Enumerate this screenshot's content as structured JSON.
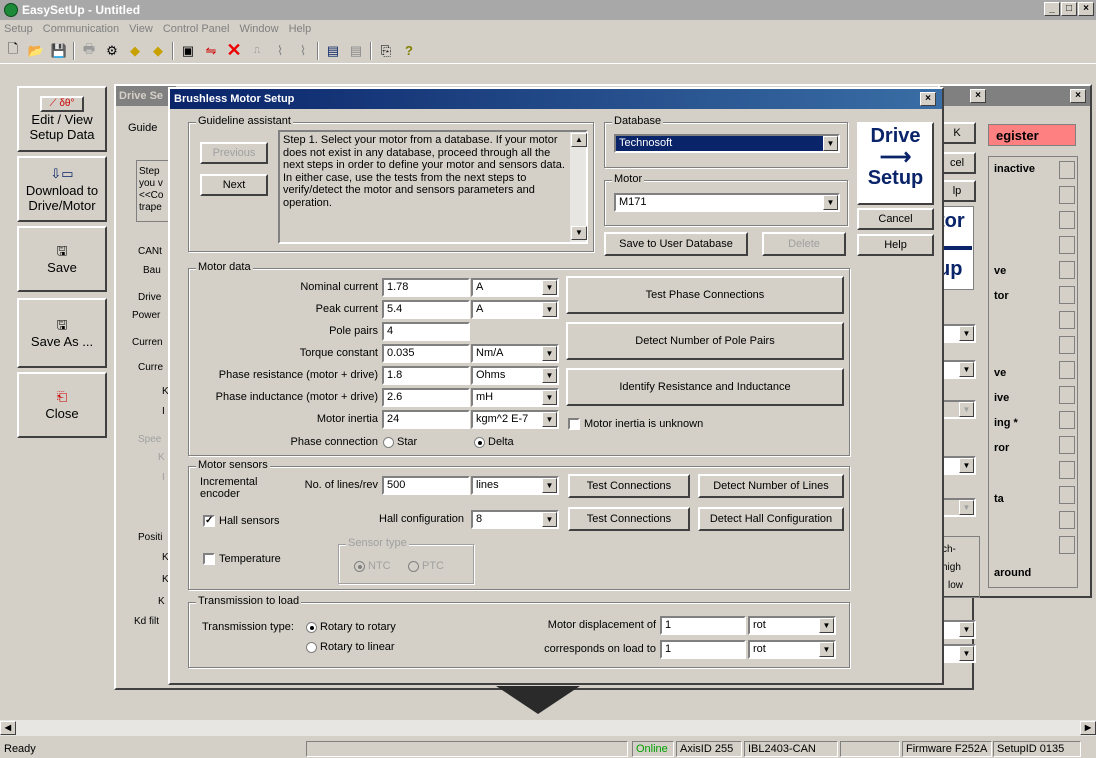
{
  "app": {
    "title": "EasySetUp - Untitled"
  },
  "menu": [
    "Setup",
    "Communication",
    "View",
    "Control Panel",
    "Window",
    "Help"
  ],
  "toolbar_icons": [
    "new-icon",
    "open-icon",
    "save-icon",
    "print-icon",
    "setup-icon",
    "go-icon",
    "go2-icon",
    "stop-icon",
    "chart-icon",
    "close-red-icon",
    "start-icon",
    "motion1-icon",
    "motion2-icon",
    "start2-icon",
    "stop2-icon",
    "comm-icon",
    "help-icon"
  ],
  "left_panel": {
    "buttons": [
      {
        "label": "Edit / View Setup Data",
        "icon": "edit-icon"
      },
      {
        "label": "Download to Drive/Motor",
        "icon": "download-icon"
      },
      {
        "label": "Save",
        "icon": "disk-icon"
      },
      {
        "label": "Save As ...",
        "icon": "disk-icon"
      },
      {
        "label": "Close",
        "icon": "close-icon"
      }
    ]
  },
  "drive_setup_window": {
    "title": "Drive Se",
    "labels": [
      "Guide",
      "Step",
      "you v",
      "<<Co",
      "trape",
      "CANt",
      "Bau",
      "Drive",
      "Power",
      "Curren",
      "Curre",
      "K",
      "I",
      "Spee",
      "K",
      "I",
      "Positi",
      "K",
      "K",
      "K",
      "Kd filt"
    ]
  },
  "register_window": {
    "title": "egister",
    "inactive": "inactive",
    "items": [
      "ve",
      "tor",
      "ve",
      "ive",
      "ing *",
      "ror",
      "ta",
      "around"
    ],
    "side_text": [
      "ch-",
      "high",
      "low"
    ],
    "buttons": [
      "K",
      "cel",
      "lp"
    ]
  },
  "dialog": {
    "title": "Brushless Motor Setup",
    "buttons": {
      "ok_partial": "K",
      "cancel": "Cancel",
      "help": "Help"
    },
    "drive_setup_logo": {
      "line1": "Drive",
      "line2": "Setup",
      "behind1": "tor",
      "behind2": "up"
    },
    "guideline": {
      "label": "Guideline assistant",
      "previous": "Previous",
      "next": "Next",
      "text": "Step 1. Select your motor from a database. If your motor does not exist in any database, proceed through all the next steps in order to define your motor and sensors data. In either case, use the tests from the next steps to verify/detect the motor and sensors parameters and operation."
    },
    "database": {
      "label": "Database",
      "value": "Technosoft",
      "motor_label": "Motor",
      "motor_value": "M171",
      "save_btn": "Save to User Database",
      "delete_btn": "Delete"
    },
    "motor_data": {
      "label": "Motor data",
      "rows": [
        {
          "label": "Nominal current",
          "value": "1.78",
          "unit": "A"
        },
        {
          "label": "Peak current",
          "value": "5.4",
          "unit": "A"
        },
        {
          "label": "Pole pairs",
          "value": "4",
          "unit": ""
        },
        {
          "label": "Torque constant",
          "value": "0.035",
          "unit": "Nm/A"
        },
        {
          "label": "Phase resistance (motor + drive)",
          "value": "1.8",
          "unit": "Ohms"
        },
        {
          "label": "Phase inductance (motor + drive)",
          "value": "2.6",
          "unit": "mH"
        },
        {
          "label": "Motor inertia",
          "value": "24",
          "unit": "kgm^2 E-7"
        }
      ],
      "test_phase": "Test Phase Connections",
      "detect_pole": "Detect Number of Pole Pairs",
      "identify_rl": "Identify Resistance and Inductance",
      "inertia_unknown": "Motor inertia is unknown",
      "phase_connection": "Phase connection",
      "star": "Star",
      "delta": "Delta"
    },
    "motor_sensors": {
      "label": "Motor sensors",
      "incremental_encoder": "Incremental encoder",
      "lines_label": "No. of lines/rev",
      "lines_value": "500",
      "lines_unit": "lines",
      "test_connections": "Test Connections",
      "detect_lines": "Detect Number of Lines",
      "hall_sensors": "Hall sensors",
      "hall_config_label": "Hall configuration",
      "hall_config_value": "8",
      "detect_hall": "Detect Hall Configuration",
      "temperature": "Temperature",
      "sensor_type": "Sensor type",
      "ntc": "NTC",
      "ptc": "PTC"
    },
    "transmission": {
      "label": "Transmission to load",
      "type_label": "Transmission type:",
      "rotary_rotary": "Rotary to rotary",
      "rotary_linear": "Rotary to linear",
      "displacement_label": "Motor displacement of",
      "displacement_value": "1",
      "displacement_unit": "rot",
      "load_label": "corresponds on load to",
      "load_value": "1",
      "load_unit": "rot"
    }
  },
  "status": {
    "ready": "Ready",
    "online": "Online",
    "axis": "AxisID 255",
    "drive": "IBL2403-CAN",
    "firmware": "Firmware F252A",
    "setup_id": "SetupID 0135"
  },
  "colors": {
    "online": "#00a000",
    "register_red": "#ff8080",
    "title_active": "#0a246a"
  }
}
